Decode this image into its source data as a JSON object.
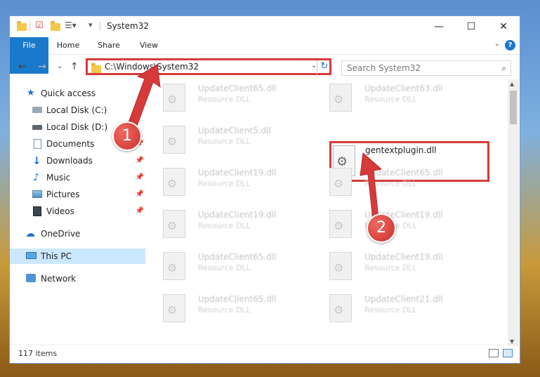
{
  "window": {
    "title": "System32",
    "controls": {
      "minimize": "—",
      "maximize": "☐",
      "close": "✕"
    }
  },
  "ribbon": {
    "tabs": [
      "File",
      "Home",
      "Share",
      "View"
    ],
    "help": "?"
  },
  "address": {
    "path": "C:\\Windows\\System32",
    "search_placeholder": "Search System32"
  },
  "sidebar": {
    "items": [
      {
        "label": "Quick access",
        "icon": "star-icon",
        "pinned": false
      },
      {
        "label": "Local Disk (C:)",
        "icon": "drive-icon",
        "pinned": false
      },
      {
        "label": "Local Disk (D:)",
        "icon": "drive-icon",
        "pinned": false
      },
      {
        "label": "Documents",
        "icon": "document-icon",
        "pinned": true
      },
      {
        "label": "Downloads",
        "icon": "download-icon",
        "pinned": true
      },
      {
        "label": "Music",
        "icon": "music-icon",
        "pinned": true
      },
      {
        "label": "Pictures",
        "icon": "picture-icon",
        "pinned": true
      },
      {
        "label": "Videos",
        "icon": "video-icon",
        "pinned": true
      },
      {
        "label": "OneDrive",
        "icon": "cloud-icon",
        "pinned": false
      },
      {
        "label": "This PC",
        "icon": "computer-icon",
        "pinned": false,
        "selected": true
      },
      {
        "label": "Network",
        "icon": "network-icon",
        "pinned": false
      }
    ]
  },
  "files": {
    "left": [
      {
        "name": "UpdateClient65.dll",
        "type": "Resource DLL"
      },
      {
        "name": "UpdateClient5.dll",
        "type": "Resource DLL"
      },
      {
        "name": "UpdateClient19.dll",
        "type": "Resource DLL"
      },
      {
        "name": "UpdateClient19.dll",
        "type": "Resource DLL"
      },
      {
        "name": "UpdateClient65.dll",
        "type": "Resource DLL"
      },
      {
        "name": "UpdateClient65.dll",
        "type": "Resource DLL"
      }
    ],
    "right": [
      {
        "name": "UpdateClient63.dll",
        "type": "Resource DLL"
      },
      {
        "name": "gentextplugin.dll",
        "type": "",
        "highlighted": true
      },
      {
        "name": "UpdateClient65.dll",
        "type": "Resource DLL"
      },
      {
        "name": "UpdateClient19.dll",
        "type": "Resource DLL"
      },
      {
        "name": "UpdateClient19.dll",
        "type": "Resource DLL"
      },
      {
        "name": "UpdateClient21.dll",
        "type": "Resource DLL"
      }
    ]
  },
  "status": {
    "item_count": "117 items"
  },
  "annotations": {
    "step1": "1",
    "step2": "2",
    "color": "#d63a3a"
  }
}
